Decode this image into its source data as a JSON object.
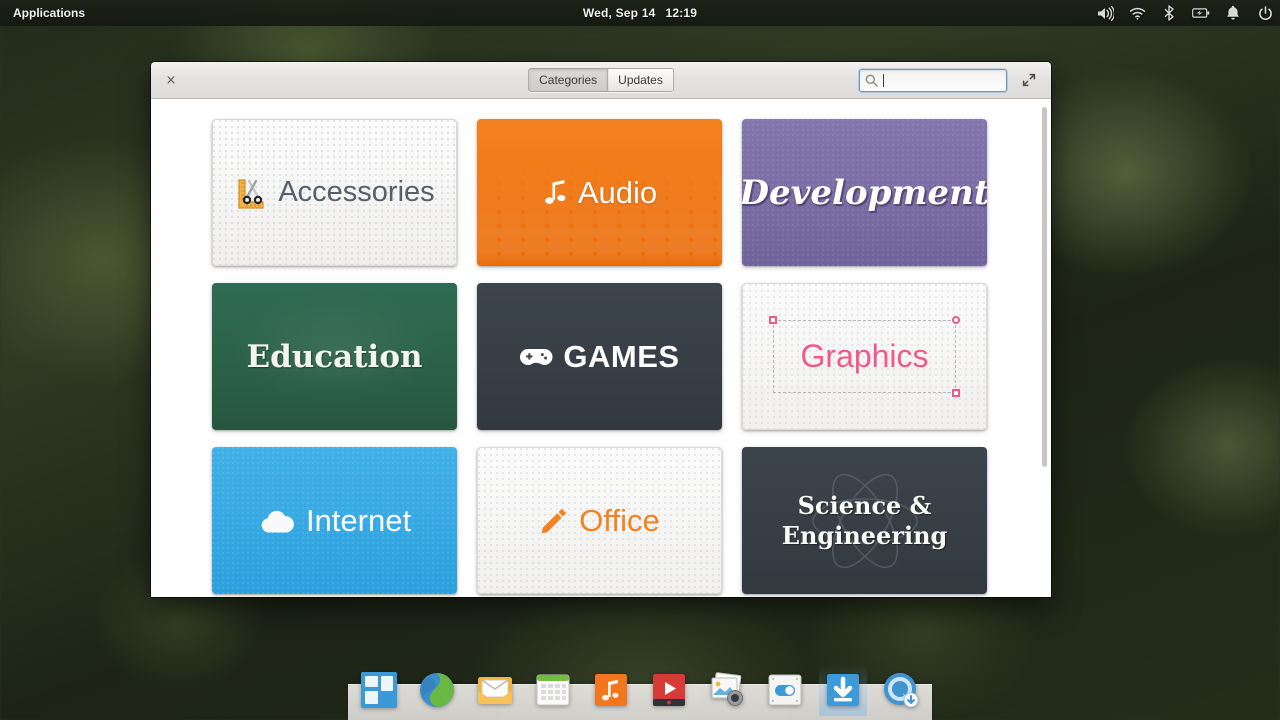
{
  "panel": {
    "applications_label": "Applications",
    "clock_date": "Wed, Sep 14",
    "clock_time": "12:19",
    "tray": [
      {
        "name": "volume-icon",
        "label": "Volume"
      },
      {
        "name": "wifi-icon",
        "label": "Wi-Fi"
      },
      {
        "name": "bluetooth-icon",
        "label": "Bluetooth"
      },
      {
        "name": "battery-icon",
        "label": "Battery"
      },
      {
        "name": "notification-bell-icon",
        "label": "Notifications"
      },
      {
        "name": "power-icon",
        "label": "Power"
      }
    ]
  },
  "window": {
    "close_label": "×",
    "maximize_label": "⤡",
    "tabs": [
      {
        "label": "Categories",
        "active": true
      },
      {
        "label": "Updates",
        "active": false
      }
    ],
    "search": {
      "value": "",
      "placeholder": ""
    }
  },
  "categories": [
    {
      "name": "accessories",
      "label": "Accessories",
      "icon": "ruler-scissors-icon",
      "color": "#f4f3f2",
      "text_color": "#57606a"
    },
    {
      "name": "audio",
      "label": "Audio",
      "icon": "music-note-icon",
      "color": "#ef7511",
      "text_color": "#ffffff"
    },
    {
      "name": "development",
      "label": "Development",
      "icon": "none",
      "color": "#7a6ea5",
      "text_color": "#ffffff"
    },
    {
      "name": "education",
      "label": "Education",
      "icon": "none",
      "color": "#2b6149",
      "text_color": "#f4f5ee"
    },
    {
      "name": "games",
      "label": "GAMES",
      "icon": "gamepad-icon",
      "color": "#373e46",
      "text_color": "#ffffff"
    },
    {
      "name": "graphics",
      "label": "Graphics",
      "icon": "selection-box-icon",
      "color": "#f4f3f2",
      "text_color": "#f4588b"
    },
    {
      "name": "internet",
      "label": "Internet",
      "icon": "cloud-icon",
      "color": "#35a8e3",
      "text_color": "#ffffff"
    },
    {
      "name": "office",
      "label": "Office",
      "icon": "pencil-icon",
      "color": "#f4f3f2",
      "text_color": "#f5821f"
    },
    {
      "name": "science",
      "label": "Science &\nEngineering",
      "icon": "atom-icon",
      "color": "#373e46",
      "text_color": "#fbfbf6"
    }
  ],
  "dock": [
    {
      "name": "dock-item-applications",
      "label": "Applications",
      "active": false
    },
    {
      "name": "dock-item-web-browser",
      "label": "Web Browser",
      "active": false
    },
    {
      "name": "dock-item-mail",
      "label": "Mail",
      "active": false
    },
    {
      "name": "dock-item-calendar",
      "label": "Calendar",
      "active": false
    },
    {
      "name": "dock-item-music",
      "label": "Music",
      "active": false
    },
    {
      "name": "dock-item-videos",
      "label": "Videos",
      "active": false
    },
    {
      "name": "dock-item-photos",
      "label": "Photos",
      "active": false
    },
    {
      "name": "dock-item-settings",
      "label": "System Settings",
      "active": false
    },
    {
      "name": "dock-item-downloads",
      "label": "Downloads",
      "active": true
    },
    {
      "name": "dock-item-app-center",
      "label": "App Center",
      "active": false
    }
  ]
}
